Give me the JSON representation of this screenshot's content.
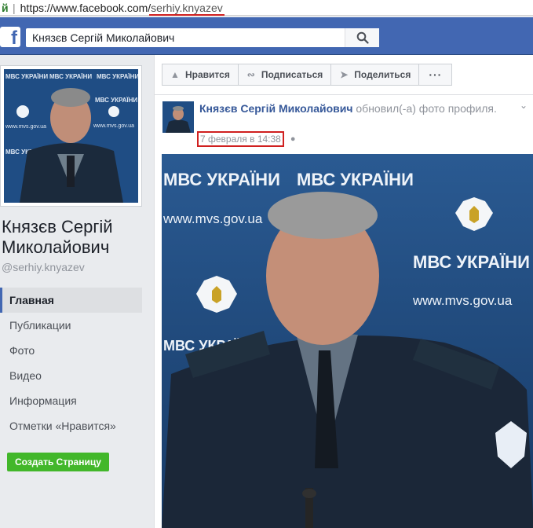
{
  "browser": {
    "url_base": "https://www.facebook.com/",
    "url_slug": "serhiy.knyazev"
  },
  "header": {
    "logo": "f",
    "search_value": "Князєв Сергій Миколайович"
  },
  "profile": {
    "name": "Князєв Сергій Миколайович",
    "handle": "@serhiy.knyazev",
    "nav": [
      "Главная",
      "Публикации",
      "Фото",
      "Видео",
      "Информация",
      "Отметки «Нравится»"
    ],
    "create_page": "Создать Страницу"
  },
  "actions": {
    "like": "Нравится",
    "follow": "Подписаться",
    "share": "Поделиться",
    "more": "···"
  },
  "post": {
    "author": "Князєв Сергій Миколайович",
    "action_text": "обновил(-а) фото профиля.",
    "timestamp": "7 февраля в 14:38"
  },
  "photo_text": {
    "mvs": "МВС УКРАЇНИ",
    "site": "www.mvs.gov.ua"
  },
  "colors": {
    "fb_blue": "#4267b2",
    "link": "#365899",
    "highlight_red": "#d02020",
    "green_button": "#42b72a"
  }
}
